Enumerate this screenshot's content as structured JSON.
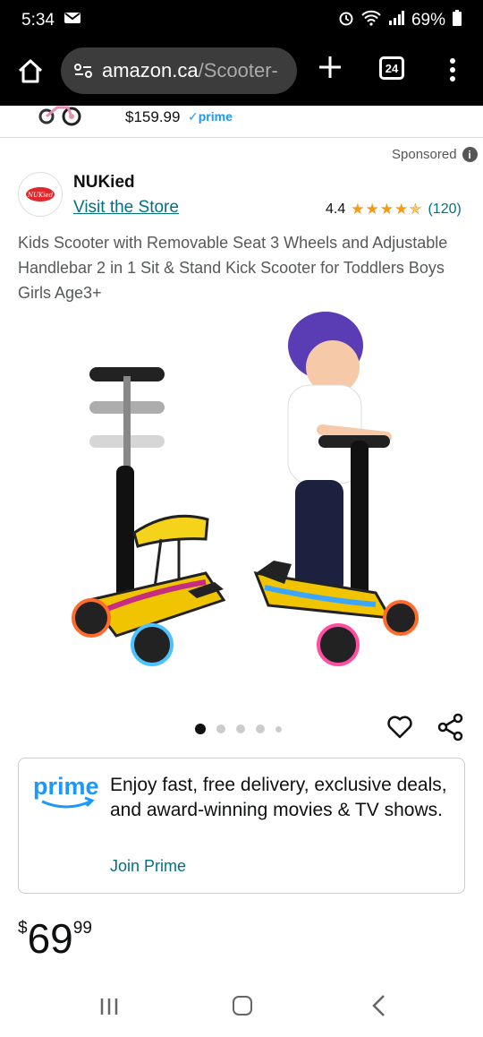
{
  "status_bar": {
    "time": "5:34",
    "battery": "69%"
  },
  "browser": {
    "url_host": "amazon.ca",
    "url_path": "/Scooter-",
    "tab_count": "24"
  },
  "prev_strip": {
    "price": "$159.99",
    "prime_label": "✓prime"
  },
  "sponsored": {
    "label": "Sponsored",
    "info_icon": "i"
  },
  "brand": {
    "name": "NUKied",
    "logo_text": "NUKied",
    "visit_store": "Visit the Store"
  },
  "rating": {
    "value": "4.4",
    "stars": "★★★★✯",
    "stars_numeric": 4.4,
    "count": "(120)"
  },
  "product": {
    "title": "Kids Scooter with Removable Seat 3 Wheels and Adjustable Handlebar 2 in 1 Sit & Stand Kick Scooter for Toddlers Boys Girls Age3+",
    "image_count": 5,
    "active_image_index": 0
  },
  "prime_card": {
    "logo_text": "prime",
    "text": "Enjoy fast, free delivery, exclusive deals, and award-winning movies & TV shows.",
    "join_label": "Join Prime"
  },
  "price": {
    "symbol": "$",
    "whole": "69",
    "fraction": "99"
  },
  "colors": {
    "link": "#007185",
    "star": "#f39b12",
    "prime_blue": "#1a98ff",
    "text": "#0F1111",
    "secondary_text": "#565959"
  }
}
